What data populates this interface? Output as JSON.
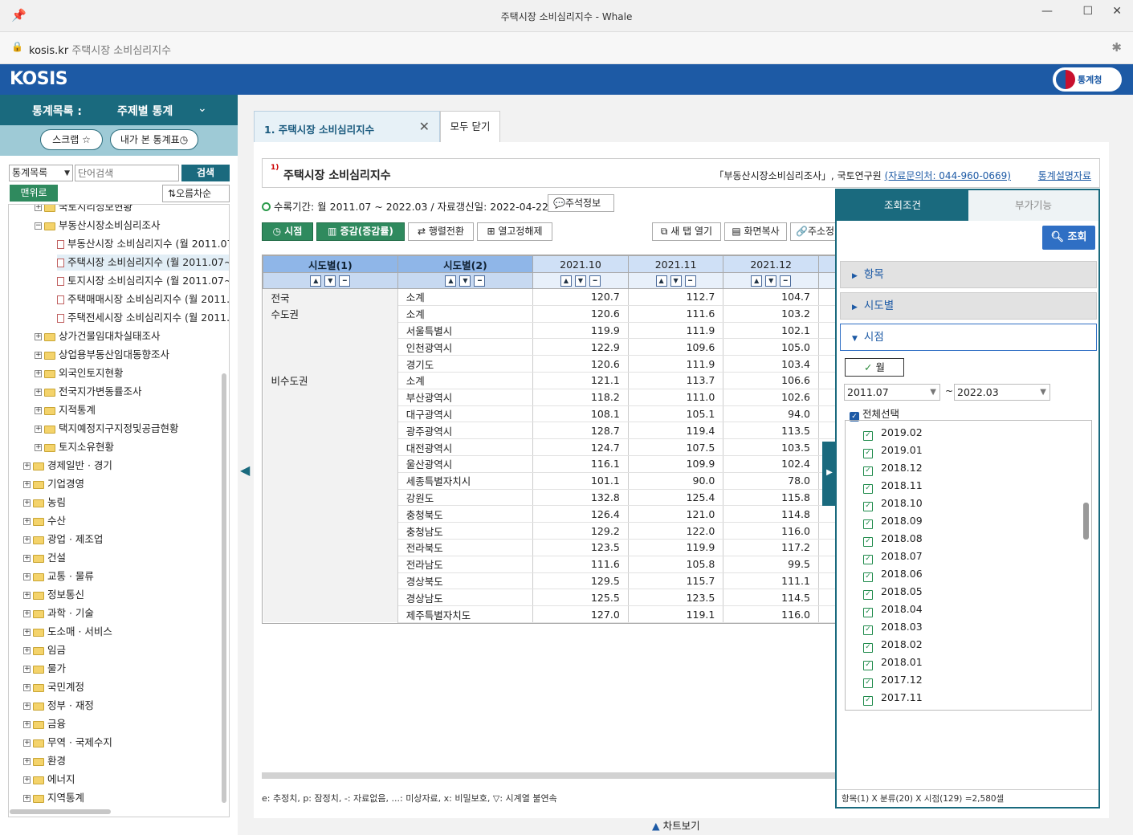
{
  "window": {
    "title": "주택시장 소비심리지수 - Whale"
  },
  "address": {
    "domain": "kosis.kr",
    "page": "주택시장 소비심리지수"
  },
  "brand": {
    "logo": "KOSIS",
    "agency": "통계청"
  },
  "left": {
    "head_label": "통계목록 :",
    "head_value": "주제별 통계",
    "scrap": "스크랩",
    "recent": "내가 본 통계표",
    "search_select": "통계목록",
    "search_placeholder": "단어검색",
    "search_btn": "검색",
    "top_btn": "맨위로",
    "sort_btn": "오름차순",
    "tree": [
      {
        "label": "국토지리정보현황",
        "lvl": 2,
        "t": "folder"
      },
      {
        "label": "부동산시장소비심리조사",
        "lvl": 2,
        "t": "folder"
      },
      {
        "label": "부동산시장 소비심리지수 (월 2011.07",
        "lvl": 3,
        "t": "doc"
      },
      {
        "label": "주택시장 소비심리지수 (월 2011.07~",
        "lvl": 3,
        "t": "doc",
        "hl": true
      },
      {
        "label": "토지시장 소비심리지수 (월 2011.07~",
        "lvl": 3,
        "t": "doc"
      },
      {
        "label": "주택매매시장 소비심리지수 (월 2011.",
        "lvl": 3,
        "t": "doc"
      },
      {
        "label": "주택전세시장 소비심리지수 (월 2011.",
        "lvl": 3,
        "t": "doc"
      },
      {
        "label": "상가건물임대차실태조사",
        "lvl": 2,
        "t": "folder"
      },
      {
        "label": "상업용부동산임대동향조사",
        "lvl": 2,
        "t": "folder"
      },
      {
        "label": "외국인토지현황",
        "lvl": 2,
        "t": "folder"
      },
      {
        "label": "전국지가변동률조사",
        "lvl": 2,
        "t": "folder"
      },
      {
        "label": "지적통계",
        "lvl": 2,
        "t": "folder"
      },
      {
        "label": "택지예정지구지정및공급현황",
        "lvl": 2,
        "t": "folder"
      },
      {
        "label": "토지소유현황",
        "lvl": 2,
        "t": "folder"
      },
      {
        "label": "경제일반 · 경기",
        "lvl": 1,
        "t": "folder"
      },
      {
        "label": "기업경영",
        "lvl": 1,
        "t": "folder"
      },
      {
        "label": "농림",
        "lvl": 1,
        "t": "folder"
      },
      {
        "label": "수산",
        "lvl": 1,
        "t": "folder"
      },
      {
        "label": "광업 · 제조업",
        "lvl": 1,
        "t": "folder"
      },
      {
        "label": "건설",
        "lvl": 1,
        "t": "folder"
      },
      {
        "label": "교통 · 물류",
        "lvl": 1,
        "t": "folder"
      },
      {
        "label": "정보통신",
        "lvl": 1,
        "t": "folder"
      },
      {
        "label": "과학 · 기술",
        "lvl": 1,
        "t": "folder"
      },
      {
        "label": "도소매 · 서비스",
        "lvl": 1,
        "t": "folder"
      },
      {
        "label": "임금",
        "lvl": 1,
        "t": "folder"
      },
      {
        "label": "물가",
        "lvl": 1,
        "t": "folder"
      },
      {
        "label": "국민계정",
        "lvl": 1,
        "t": "folder"
      },
      {
        "label": "정부 · 재정",
        "lvl": 1,
        "t": "folder"
      },
      {
        "label": "금융",
        "lvl": 1,
        "t": "folder"
      },
      {
        "label": "무역 · 국제수지",
        "lvl": 1,
        "t": "folder"
      },
      {
        "label": "환경",
        "lvl": 1,
        "t": "folder"
      },
      {
        "label": "에너지",
        "lvl": 1,
        "t": "folder"
      },
      {
        "label": "지역통계",
        "lvl": 1,
        "t": "folder"
      }
    ]
  },
  "tabs": {
    "active": "1. 주택시장 소비심리지수",
    "close_all": "모두 닫기"
  },
  "header": {
    "title": "주택시장 소비심리지수",
    "source": "「부동산시장소비심리조사」, 국토연구원",
    "contact": "(자료문의처: 044-960-0669)",
    "explain": "통계설명자료"
  },
  "period": {
    "text": "수록기간: 월 2011.07 ~ 2022.03 / 자료갱신일: 2022-04-22 /",
    "note_btn": "주석정보"
  },
  "toolbar": {
    "time": "시점",
    "change": "증감(증감률)",
    "pivot": "행렬전환",
    "unfix": "열고정해제",
    "newtab": "새 탭 열기",
    "copy": "화면복사",
    "url": "주소정"
  },
  "table": {
    "h1": "시도별(1)",
    "h2": "시도별(2)",
    "cols": [
      "2021.10",
      "2021.11",
      "2021.12"
    ],
    "rows": [
      {
        "g": "전국",
        "s": "소계",
        "v": [
          "120.7",
          "112.7",
          "104.7"
        ]
      },
      {
        "g": "수도권",
        "s": "소계",
        "v": [
          "120.6",
          "111.6",
          "103.2"
        ]
      },
      {
        "g": "",
        "s": "서울특별시",
        "v": [
          "119.9",
          "111.9",
          "102.1"
        ]
      },
      {
        "g": "",
        "s": "인천광역시",
        "v": [
          "122.9",
          "109.6",
          "105.0"
        ]
      },
      {
        "g": "",
        "s": "경기도",
        "v": [
          "120.6",
          "111.9",
          "103.4"
        ]
      },
      {
        "g": "비수도권",
        "s": "소계",
        "v": [
          "121.1",
          "113.7",
          "106.6"
        ]
      },
      {
        "g": "",
        "s": "부산광역시",
        "v": [
          "118.2",
          "111.0",
          "102.6"
        ]
      },
      {
        "g": "",
        "s": "대구광역시",
        "v": [
          "108.1",
          "105.1",
          "94.0"
        ]
      },
      {
        "g": "",
        "s": "광주광역시",
        "v": [
          "128.7",
          "119.4",
          "113.5"
        ]
      },
      {
        "g": "",
        "s": "대전광역시",
        "v": [
          "124.7",
          "107.5",
          "103.5"
        ]
      },
      {
        "g": "",
        "s": "울산광역시",
        "v": [
          "116.1",
          "109.9",
          "102.4"
        ]
      },
      {
        "g": "",
        "s": "세종특별자치시",
        "v": [
          "101.1",
          "90.0",
          "78.0"
        ]
      },
      {
        "g": "",
        "s": "강원도",
        "v": [
          "132.8",
          "125.4",
          "115.8"
        ]
      },
      {
        "g": "",
        "s": "충청북도",
        "v": [
          "126.4",
          "121.0",
          "114.8"
        ]
      },
      {
        "g": "",
        "s": "충청남도",
        "v": [
          "129.2",
          "122.0",
          "116.0"
        ]
      },
      {
        "g": "",
        "s": "전라북도",
        "v": [
          "123.5",
          "119.9",
          "117.2"
        ]
      },
      {
        "g": "",
        "s": "전라남도",
        "v": [
          "111.6",
          "105.8",
          "99.5"
        ]
      },
      {
        "g": "",
        "s": "경상북도",
        "v": [
          "129.5",
          "115.7",
          "111.1"
        ]
      },
      {
        "g": "",
        "s": "경상남도",
        "v": [
          "125.5",
          "123.5",
          "114.5"
        ]
      },
      {
        "g": "",
        "s": "제주특별자치도",
        "v": [
          "127.0",
          "119.1",
          "116.0"
        ]
      }
    ]
  },
  "footnote": "e: 추정치, p: 잠정치, -: 자료없음, ...: 미상자료, x: 비밀보호, ▽: 시계열 불연속",
  "chart_view": "차트보기",
  "right": {
    "tab_query": "조회조건",
    "tab_extra": "부가기능",
    "query_btn": "조회",
    "acc_item": "항목",
    "acc_region": "시도별",
    "acc_time": "시점",
    "month": "월",
    "from": "2011.07",
    "to": "2022.03",
    "tilde": "~",
    "select_all": "전체선택",
    "periods": [
      "2019.02",
      "2019.01",
      "2018.12",
      "2018.11",
      "2018.10",
      "2018.09",
      "2018.08",
      "2018.07",
      "2018.06",
      "2018.05",
      "2018.04",
      "2018.03",
      "2018.02",
      "2018.01",
      "2017.12",
      "2017.11"
    ],
    "summary": "항목(1) X 분류(20) X 시점(129) =2,580셀"
  }
}
